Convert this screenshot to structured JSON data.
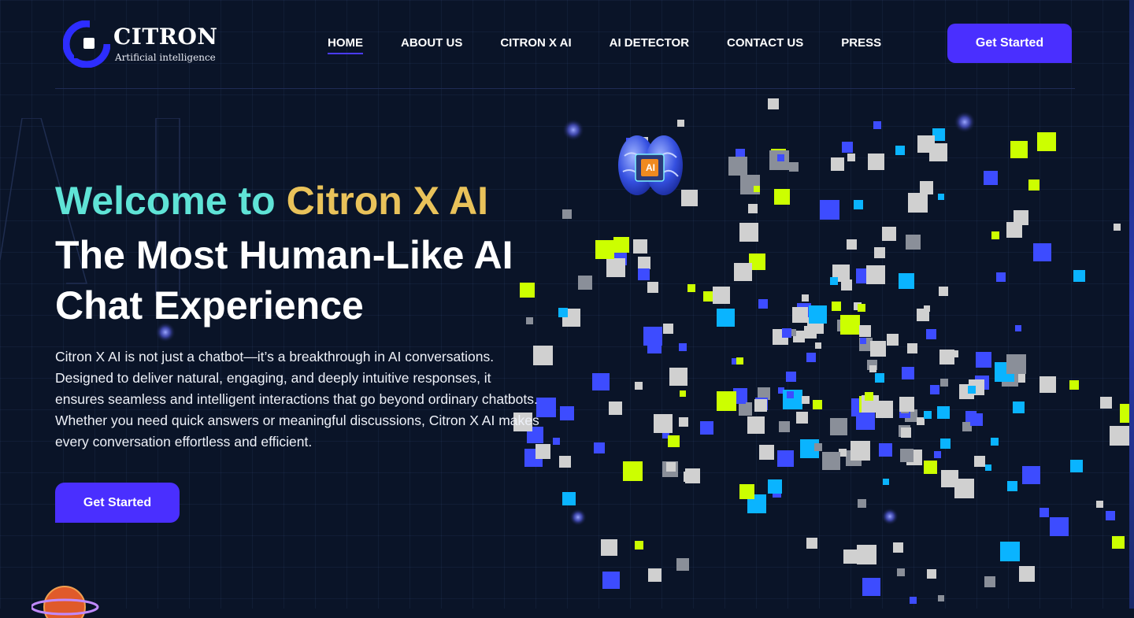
{
  "brand": {
    "name": "CITRON",
    "tagline": "Artificial intelligence"
  },
  "nav": {
    "items": [
      {
        "label": "HOME",
        "active": true
      },
      {
        "label": "ABOUT US",
        "active": false
      },
      {
        "label": "CITRON X AI",
        "active": false
      },
      {
        "label": "AI DETECTOR",
        "active": false
      },
      {
        "label": "CONTACT US",
        "active": false
      },
      {
        "label": "PRESS",
        "active": false
      }
    ],
    "cta_label": "Get Started"
  },
  "hero": {
    "welcome": "Welcome to",
    "brand_highlight": "Citron X AI",
    "headline": "The Most Human-Like AI Chat Experience",
    "description": "Citron X AI is not just a chatbot—it’s a breakthrough in AI conversations. Designed to deliver natural, engaging, and deeply intuitive responses, it ensures seamless and intelligent interactions that go beyond ordinary chatbots. Whether you need quick answers or meaningful discussions, Citron X AI makes every conversation effortless and efficient.",
    "cta_label": "Get Started",
    "chip_label": "AI"
  },
  "colors": {
    "background": "#0a1428",
    "accent": "#4a2fff",
    "welcome_text": "#5fe3d6",
    "brand_highlight": "#e9c25a",
    "pixel_blue": "#3d4cff",
    "pixel_cyan": "#0ab4ff",
    "pixel_lime": "#ccff00",
    "pixel_grey": "#d0d0d0"
  },
  "icons": {
    "logo": "citron-logo-icon",
    "brain": "ai-brain-chip-icon",
    "planet": "planet-icon"
  }
}
